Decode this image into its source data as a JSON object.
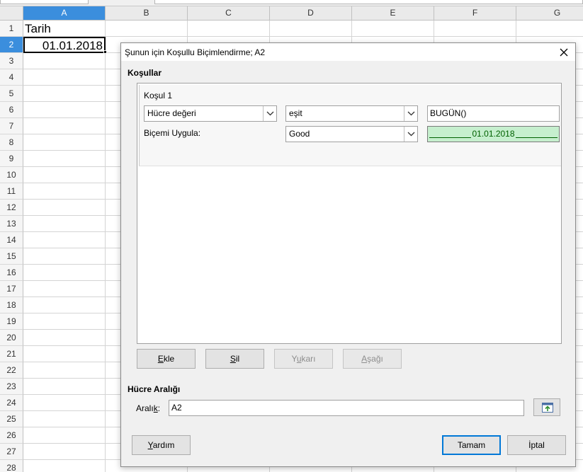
{
  "sheet": {
    "columns": [
      "A",
      "B",
      "C",
      "D",
      "E",
      "F",
      "G"
    ],
    "selected_column": "A",
    "rows": [
      "1",
      "2",
      "3",
      "4",
      "5",
      "6",
      "7",
      "8",
      "9",
      "10",
      "11",
      "12",
      "13",
      "14",
      "15",
      "16",
      "17",
      "18",
      "19",
      "20",
      "21",
      "22",
      "23",
      "24",
      "25",
      "26",
      "27",
      "28"
    ],
    "selected_row": "2",
    "cells": {
      "A1": "Tarih",
      "A2": "01.01.2018"
    }
  },
  "dialog": {
    "title": "Şunun için Koşullu Biçimlendirme; A2",
    "close_icon": "close-icon",
    "conditions_heading": "Koşullar",
    "condition": {
      "label": "Koşul 1",
      "type_value": "Hücre değeri",
      "operator_value": "eşit",
      "expression_value": "BUGÜN()",
      "apply_style_label": "Biçemi Uygula:",
      "style_value": "Good",
      "preview_text": "01.01.2018"
    },
    "list_buttons": {
      "add": {
        "pre": "",
        "mnemonic": "E",
        "post": "kle"
      },
      "remove": {
        "pre": "",
        "mnemonic": "S",
        "post": "il"
      },
      "up": {
        "pre": "Y",
        "mnemonic": "u",
        "post": "karı"
      },
      "down": {
        "pre": "",
        "mnemonic": "A",
        "post": "şağı"
      }
    },
    "range_heading": "Hücre Aralığı",
    "range_label": {
      "pre": "Aralı",
      "mnemonic": "k",
      "post": ":"
    },
    "range_value": "A2",
    "shrink_icon": "shrink-range-icon",
    "footer_buttons": {
      "help": {
        "pre": "",
        "mnemonic": "Y",
        "post": "ardım"
      },
      "ok": "Tamam",
      "cancel": "İptal"
    },
    "colors": {
      "good_background": "#c6efce",
      "good_text": "#006100",
      "selection_header": "#3b8edd",
      "default_button_border": "#0078d7"
    }
  }
}
